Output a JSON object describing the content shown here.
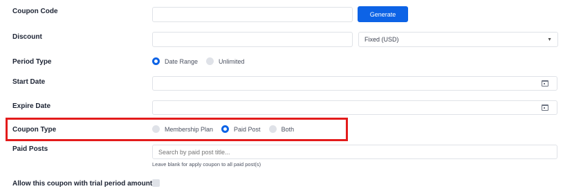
{
  "form": {
    "coupon_code": {
      "label": "Coupon Code",
      "value": "",
      "button": "Generate"
    },
    "discount": {
      "label": "Discount",
      "value": "",
      "type_selected": "Fixed (USD)"
    },
    "period_type": {
      "label": "Period Type",
      "options": [
        "Date Range",
        "Unlimited"
      ],
      "selected": "Date Range"
    },
    "start_date": {
      "label": "Start Date",
      "value": ""
    },
    "expire_date": {
      "label": "Expire Date",
      "value": ""
    },
    "coupon_type": {
      "label": "Coupon Type",
      "options": [
        "Membership Plan",
        "Paid Post",
        "Both"
      ],
      "selected": "Paid Post"
    },
    "paid_posts": {
      "label": "Paid Posts",
      "placeholder": "Search by paid post title...",
      "helper": "Leave blank for apply coupon to all paid post(s)"
    },
    "trial": {
      "label": "Allow this coupon with trial period amount",
      "checked": false
    }
  },
  "colors": {
    "accent": "#0d63e6",
    "highlight": "#e31b1b"
  },
  "icons": {
    "date_picker": "calendar-icon",
    "dropdown": "chevron-down-icon"
  }
}
